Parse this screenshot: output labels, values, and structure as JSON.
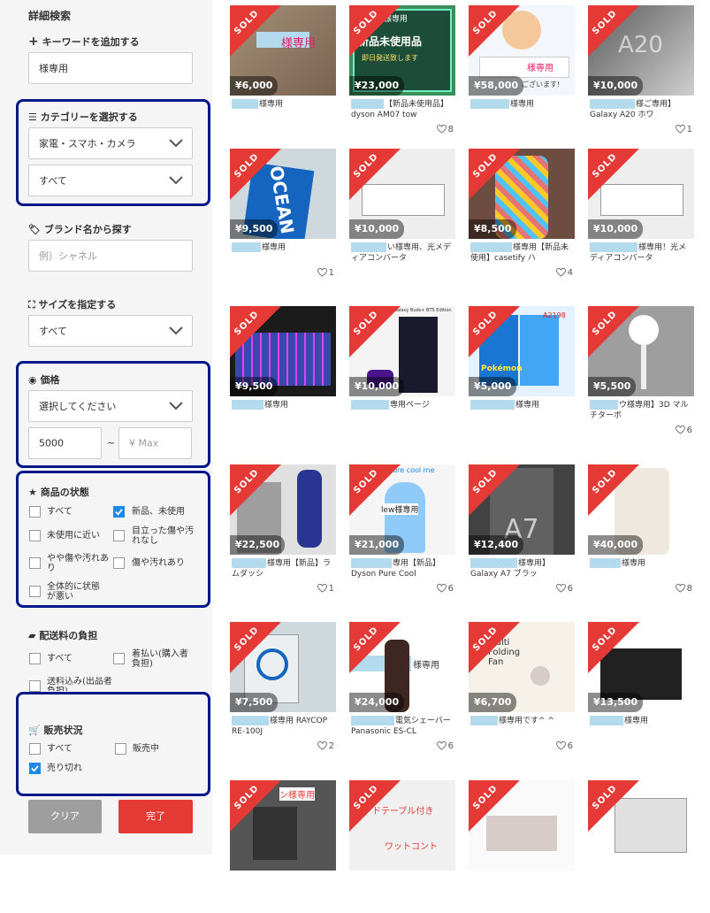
{
  "sidebar": {
    "title": "詳細検索",
    "keyword": {
      "label": "キーワードを追加する",
      "value": "様専用"
    },
    "category": {
      "label": "カテゴリーを選択する",
      "main": "家電・スマホ・カメラ",
      "sub": "すべて"
    },
    "brand": {
      "label": "ブランド名から探す",
      "placeholder": "例）シャネル"
    },
    "size": {
      "label": "サイズを指定する",
      "value": "すべて"
    },
    "price": {
      "label": "価格",
      "select": "選択してください",
      "min": "5000",
      "separator": "~",
      "max_placeholder": "¥ Max"
    },
    "condition": {
      "label": "商品の状態",
      "options": [
        {
          "label": "すべて",
          "checked": false
        },
        {
          "label": "新品、未使用",
          "checked": true
        },
        {
          "label": "未使用に近い",
          "checked": false
        },
        {
          "label": "目立った傷や汚れなし",
          "checked": false
        },
        {
          "label": "やや傷や汚れあり",
          "checked": false
        },
        {
          "label": "傷や汚れあり",
          "checked": false
        },
        {
          "label": "全体的に状態が悪い",
          "checked": false
        }
      ]
    },
    "shipping": {
      "label": "配送料の負担",
      "options": [
        {
          "label": "すべて",
          "checked": false
        },
        {
          "label": "着払い(購入者負担)",
          "checked": false
        },
        {
          "label": "送料込み(出品者負担)",
          "checked": false
        }
      ]
    },
    "sale_status": {
      "label": "販売状況",
      "options": [
        {
          "label": "すべて",
          "checked": false
        },
        {
          "label": "販売中",
          "checked": false
        },
        {
          "label": "売り切れ",
          "checked": true
        }
      ]
    },
    "clear_label": "クリア",
    "submit_label": "完了"
  },
  "colors": {
    "highlight": "#00178a",
    "sold": "#e53935",
    "submit": "#e53935",
    "clear": "#9e9e9e",
    "check": "#1e88e5",
    "mask": "#b3dbed"
  },
  "sold_label": "SOLD",
  "products": [
    {
      "price": "¥6,000",
      "title": "様専用",
      "likes": ""
    },
    {
      "price": "¥23,000",
      "title": "【新品未使用品】dyson AM07 tow",
      "likes": "8"
    },
    {
      "price": "¥58,000",
      "title": "様専用",
      "likes": ""
    },
    {
      "price": "¥10,000",
      "title": "様ご専用】Galaxy A20 ホワ",
      "likes": "1"
    },
    {
      "price": "¥9,500",
      "title": "様専用",
      "likes": "1"
    },
    {
      "price": "¥10,000",
      "title": "い様専用、光メディアコンバータ",
      "likes": ""
    },
    {
      "price": "¥8,500",
      "title": "様専用【新品未使用】casetify ハ",
      "likes": "4"
    },
    {
      "price": "¥10,000",
      "title": "様専用！光メディアコンバータ",
      "likes": ""
    },
    {
      "price": "¥9,500",
      "title": "様専用",
      "likes": ""
    },
    {
      "price": "¥10,000",
      "title": "専用ページ",
      "likes": ""
    },
    {
      "price": "¥5,000",
      "title": "様専用",
      "likes": ""
    },
    {
      "price": "¥5,500",
      "title": "ウ様専用】3D マルチターボ",
      "likes": "6"
    },
    {
      "price": "¥22,500",
      "title": "様専用【新品】ラムダッシ",
      "likes": "1"
    },
    {
      "price": "¥21,000",
      "title": "専用【新品】Dyson Pure Cool",
      "likes": "6"
    },
    {
      "price": "¥12,400",
      "title": "様専用】Galaxy A7 ブラッ",
      "likes": "6"
    },
    {
      "price": "¥40,000",
      "title": "様専用",
      "likes": "8"
    },
    {
      "price": "¥7,500",
      "title": "様専用 RAYCOP RE-100J",
      "likes": "2"
    },
    {
      "price": "¥24,000",
      "title": "電気シェーバー Panasonic ES-CL",
      "likes": "6"
    },
    {
      "price": "¥6,700",
      "title": "様専用です^ ^",
      "likes": "6"
    },
    {
      "price": "¥13,500",
      "title": "様専用",
      "likes": ""
    },
    {
      "price": "",
      "title": "",
      "likes": ""
    },
    {
      "price": "",
      "title": "",
      "likes": ""
    },
    {
      "price": "",
      "title": "",
      "likes": ""
    },
    {
      "price": "",
      "title": "",
      "likes": ""
    }
  ],
  "thumb_text": {
    "p1": "様専用",
    "p2a": "ル様専用",
    "p2b": "新品未使用品",
    "p2c": "即日発送致します",
    "p3a": "様専用",
    "p3b": "ございます!",
    "p4": "A20",
    "p5": "OCEAN",
    "p10": "Galaxy Buds+ BTS Edition",
    "p11": "A2198",
    "p11b": "Pokémon",
    "p14": "pure cool me",
    "p14b": "lew様専用",
    "p15": "A7",
    "p18": "様専用",
    "p19": "Multi Folding Fan",
    "p21": "ン様専用",
    "p22": "ドテーブル付き",
    "p22b": "ワットコント"
  }
}
